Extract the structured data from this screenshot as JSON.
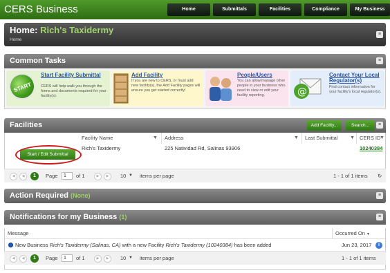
{
  "app": {
    "brand": "CERS Business"
  },
  "nav": [
    "Home",
    "Submittals",
    "Facilities",
    "Compliance",
    "My Business"
  ],
  "home": {
    "title_prefix": "Home: ",
    "business_name": "Rich's Taxidermy",
    "breadcrumb": "Home"
  },
  "common_tasks": {
    "title": "Common Tasks",
    "start_label": "START",
    "items": [
      {
        "title": "Start Facility Submittal",
        "desc": "CERS will help walk you through the forms and documents required for your facility(s)."
      },
      {
        "title": "Add Facility",
        "desc": "If you are new to CERS, or must add new facility(s), the Add Facility pages will ensure you get started correctly!"
      },
      {
        "title": "People/Users",
        "desc": "You can allow/manage other people in your business who need to view or edit your facility reporting."
      },
      {
        "title": "Contact Your Local Regulator(s)",
        "desc": "Find contact information for your facility's local regulator(s)."
      }
    ]
  },
  "facilities": {
    "title": "Facilities",
    "add_button": "Add Facility...",
    "search_button": "Search...",
    "columns": [
      "Facility Name",
      "Address",
      "Last Submittal",
      "CERS ID"
    ],
    "rows": [
      {
        "action": "Start / Edit Submittal",
        "name": "Rich's Taxidermy",
        "address": "225 Natividad Rd, Salinas 93906",
        "last_submittal": "",
        "cers_id": "10240384"
      }
    ],
    "pager": {
      "page_label": "Page",
      "page": "1",
      "of_label": "of 1",
      "page_size": "10",
      "per_page_label": "items per page",
      "summary": "1 - 1 of 1 items"
    }
  },
  "action_required": {
    "title": "Action Required",
    "count": "(None)"
  },
  "notifications": {
    "title": "Notifications for my Business",
    "count": "(1)",
    "columns": {
      "message": "Message",
      "occurred": "Occurred On"
    },
    "rows": [
      {
        "prefix": "New Business ",
        "biz": "Rich's Taxidermy (Salinas, CA)",
        "mid": " with a new Facility ",
        "fac": "Rich's Taxidermy (10240384)",
        "suffix": " has been added",
        "date": "Jun 23, 2017"
      }
    ],
    "pager": {
      "page_label": "Page",
      "page": "1",
      "of_label": "of 1",
      "page_size": "10",
      "per_page_label": "items per page",
      "summary": "1 - 1 of 1 items"
    }
  },
  "colors": {
    "brand_green": "#2e6d13",
    "link_blue": "#2a55a8",
    "highlight_red": "#cc1a1a"
  },
  "icons": [
    "start-icon",
    "filing-cabinet-icon",
    "people-icon",
    "email-icon",
    "collapse-icon",
    "filter-icon",
    "refresh-icon",
    "info-icon"
  ]
}
